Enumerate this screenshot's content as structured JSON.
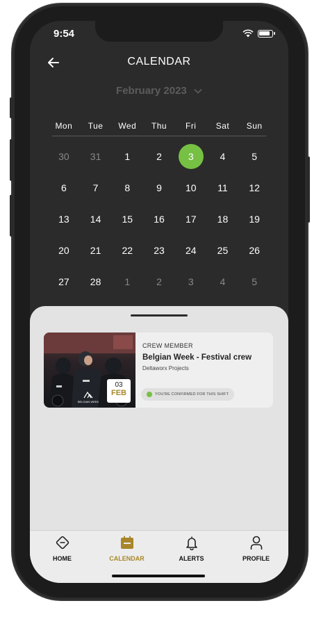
{
  "status_bar": {
    "time": "9:54"
  },
  "header": {
    "title": "CALENDAR"
  },
  "month_selector": {
    "label": "February 2023"
  },
  "weekdays": [
    "Mon",
    "Tue",
    "Wed",
    "Thu",
    "Fri",
    "Sat",
    "Sun"
  ],
  "calendar": {
    "weeks": [
      [
        {
          "d": "30",
          "m": true
        },
        {
          "d": "31",
          "m": true
        },
        {
          "d": "1"
        },
        {
          "d": "2"
        },
        {
          "d": "3",
          "sel": true
        },
        {
          "d": "4"
        },
        {
          "d": "5"
        }
      ],
      [
        {
          "d": "6"
        },
        {
          "d": "7"
        },
        {
          "d": "8"
        },
        {
          "d": "9"
        },
        {
          "d": "10"
        },
        {
          "d": "11"
        },
        {
          "d": "12"
        }
      ],
      [
        {
          "d": "13"
        },
        {
          "d": "14"
        },
        {
          "d": "15"
        },
        {
          "d": "16"
        },
        {
          "d": "17"
        },
        {
          "d": "18"
        },
        {
          "d": "19"
        }
      ],
      [
        {
          "d": "20"
        },
        {
          "d": "21"
        },
        {
          "d": "22"
        },
        {
          "d": "23"
        },
        {
          "d": "24"
        },
        {
          "d": "25"
        },
        {
          "d": "26"
        }
      ],
      [
        {
          "d": "27"
        },
        {
          "d": "28"
        },
        {
          "d": "1",
          "m": true
        },
        {
          "d": "2",
          "m": true
        },
        {
          "d": "3",
          "m": true
        },
        {
          "d": "4",
          "m": true
        },
        {
          "d": "5",
          "m": true
        }
      ]
    ]
  },
  "shift": {
    "role": "CREW MEMBER",
    "title": "Belgian Week - Festival crew",
    "organization": "Deltaworx Projects",
    "date_day": "03",
    "date_month": "FEB",
    "confirmation": "YOU'RE CONFIRMED FOR THIS SHIFT",
    "photo_caption": "BELGIAN WEEK"
  },
  "tabs": [
    {
      "label": "HOME",
      "icon": "home-icon"
    },
    {
      "label": "CALENDAR",
      "icon": "calendar-icon",
      "active": true
    },
    {
      "label": "ALERTS",
      "icon": "bell-icon"
    },
    {
      "label": "PROFILE",
      "icon": "user-icon"
    }
  ],
  "colors": {
    "accent_green": "#76c043",
    "accent_gold": "#a8862a",
    "screen_dark": "#2b2b2b",
    "sheet_light": "#e3e3e3"
  }
}
